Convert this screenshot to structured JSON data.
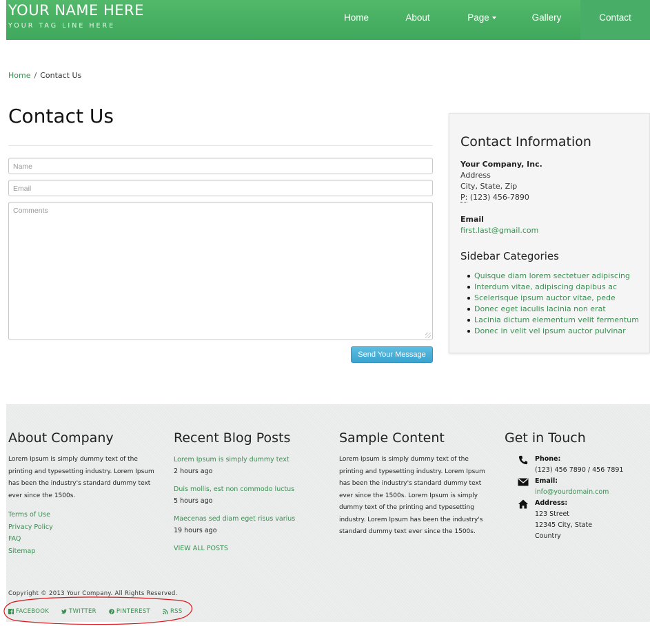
{
  "header": {
    "brand_name": "YOUR NAME HERE",
    "brand_tagline": "YOUR TAG LINE HERE",
    "nav": [
      {
        "label": "Home"
      },
      {
        "label": "About"
      },
      {
        "label": "Page"
      },
      {
        "label": "Gallery"
      },
      {
        "label": "Contact"
      }
    ]
  },
  "breadcrumb": {
    "home": "Home",
    "sep": "/",
    "current": "Contact Us"
  },
  "main": {
    "title": "Contact Us",
    "form": {
      "name_placeholder": "Name",
      "email_placeholder": "Email",
      "comments_placeholder": "Comments",
      "submit_label": "Send Your Message"
    }
  },
  "sidebar": {
    "title": "Contact Information",
    "company": "Your Company, Inc.",
    "address": "Address",
    "city": "City, State, Zip",
    "phone_abbr": "P:",
    "phone": "(123) 456-7890",
    "email_label": "Email",
    "email": "first.last@gmail.com",
    "categories_title": "Sidebar Categories",
    "categories": [
      "Quisque diam lorem sectetuer adipiscing",
      "Interdum vitae, adipiscing dapibus ac",
      "Scelerisque ipsum auctor vitae, pede",
      "Donec eget iaculis lacinia non erat",
      "Lacinia dictum elementum velit fermentum",
      "Donec in velit vel ipsum auctor pulvinar"
    ]
  },
  "footer": {
    "about": {
      "title": "About Company",
      "text": "Lorem Ipsum is simply dummy text of the printing and typesetting industry. Lorem Ipsum has been the industry's standard dummy text ever since the 1500s.",
      "links": [
        "Terms of Use",
        "Privacy Policy",
        "FAQ",
        "Sitemap"
      ]
    },
    "blog": {
      "title": "Recent Blog Posts",
      "posts": [
        {
          "title": "Lorem Ipsum is simply dummy text",
          "time": "2 hours ago"
        },
        {
          "title": "Duis mollis, est non commodo luctus",
          "time": "5 hours ago"
        },
        {
          "title": "Maecenas sed diam eget risus varius",
          "time": "19 hours ago"
        }
      ],
      "view_all": "VIEW ALL POSTS"
    },
    "sample": {
      "title": "Sample Content",
      "text": "Lorem Ipsum is simply dummy text of the printing and typesetting industry. Lorem Ipsum has been the industry's standard dummy text ever since the 1500s. Lorem Ipsum is simply dummy text of the printing and typesetting industry. Lorem Ipsum has been the industry's standard dummy text ever since the 1500s."
    },
    "touch": {
      "title": "Get in Touch",
      "phone_label": "Phone:",
      "phone": "(123) 456 7890 / 456 7891",
      "email_label": "Email:",
      "email": "info@yourdomain.com",
      "address_label": "Address:",
      "address_line1": "123 Street",
      "address_line2": "12345 City, State",
      "address_line3": "Country"
    },
    "copyright": "Copyright © 2013 Your Company. All Rights Reserved.",
    "social": [
      {
        "label": "FACEBOOK",
        "icon": "facebook-icon"
      },
      {
        "label": "TWITTER",
        "icon": "twitter-icon"
      },
      {
        "label": "PINTEREST",
        "icon": "pinterest-icon"
      },
      {
        "label": "RSS",
        "icon": "rss-icon"
      }
    ]
  },
  "colors": {
    "brand_green": "#48ad66",
    "link_green": "#3a8f52",
    "button_blue": "#45abd6",
    "annotation_red": "#d9161a"
  }
}
